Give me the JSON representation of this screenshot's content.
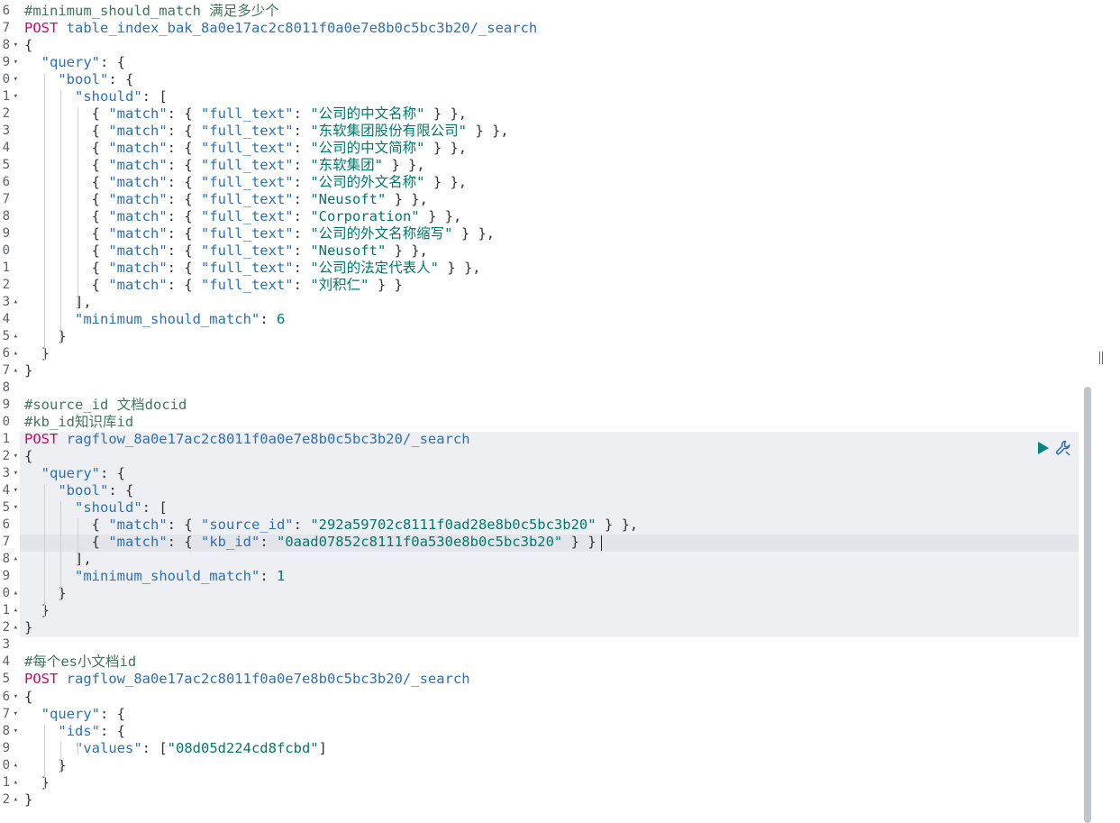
{
  "editor": {
    "gutter": [
      {
        "num": "6",
        "fold": ""
      },
      {
        "num": "7",
        "fold": ""
      },
      {
        "num": "8",
        "fold": "▾"
      },
      {
        "num": "9",
        "fold": "▾"
      },
      {
        "num": "0",
        "fold": "▾"
      },
      {
        "num": "1",
        "fold": "▾"
      },
      {
        "num": "2",
        "fold": ""
      },
      {
        "num": "3",
        "fold": ""
      },
      {
        "num": "4",
        "fold": ""
      },
      {
        "num": "5",
        "fold": ""
      },
      {
        "num": "6",
        "fold": ""
      },
      {
        "num": "7",
        "fold": ""
      },
      {
        "num": "8",
        "fold": ""
      },
      {
        "num": "9",
        "fold": ""
      },
      {
        "num": "0",
        "fold": ""
      },
      {
        "num": "1",
        "fold": ""
      },
      {
        "num": "2",
        "fold": ""
      },
      {
        "num": "3",
        "fold": "▴"
      },
      {
        "num": "4",
        "fold": ""
      },
      {
        "num": "5",
        "fold": "▴"
      },
      {
        "num": "6",
        "fold": "▴"
      },
      {
        "num": "7",
        "fold": "▴"
      },
      {
        "num": "8",
        "fold": ""
      },
      {
        "num": "9",
        "fold": ""
      },
      {
        "num": "0",
        "fold": ""
      },
      {
        "num": "1",
        "fold": ""
      },
      {
        "num": "2",
        "fold": "▾"
      },
      {
        "num": "3",
        "fold": "▾"
      },
      {
        "num": "4",
        "fold": "▾"
      },
      {
        "num": "5",
        "fold": "▾"
      },
      {
        "num": "6",
        "fold": ""
      },
      {
        "num": "7",
        "fold": ""
      },
      {
        "num": "8",
        "fold": "▴"
      },
      {
        "num": "9",
        "fold": ""
      },
      {
        "num": "0",
        "fold": "▴"
      },
      {
        "num": "1",
        "fold": "▴"
      },
      {
        "num": "2",
        "fold": "▴"
      },
      {
        "num": "3",
        "fold": ""
      },
      {
        "num": "4",
        "fold": ""
      },
      {
        "num": "5",
        "fold": ""
      },
      {
        "num": "6",
        "fold": "▾"
      },
      {
        "num": "7",
        "fold": "▾"
      },
      {
        "num": "8",
        "fold": "▾"
      },
      {
        "num": "9",
        "fold": ""
      },
      {
        "num": "0",
        "fold": "▴"
      },
      {
        "num": "1",
        "fold": "▴"
      },
      {
        "num": "2",
        "fold": "▴"
      }
    ],
    "lines": [
      [
        [
          "cmt",
          "#minimum_should_match 满足多少个"
        ]
      ],
      [
        [
          "mth",
          "POST"
        ],
        [
          "url",
          " table_index_bak_8a0e17ac2c8011f0a0e7e8b0c5bc3b20/_search"
        ]
      ],
      [
        [
          "pun",
          "{"
        ]
      ],
      [
        [
          "pun",
          "  "
        ],
        [
          "key",
          "\"query\""
        ],
        [
          "pun",
          ": {"
        ]
      ],
      [
        [
          "pun",
          "    "
        ],
        [
          "key",
          "\"bool\""
        ],
        [
          "pun",
          ": {"
        ]
      ],
      [
        [
          "pun",
          "      "
        ],
        [
          "key",
          "\"should\""
        ],
        [
          "pun",
          ": ["
        ]
      ],
      [
        [
          "pun",
          "        { "
        ],
        [
          "key",
          "\"match\""
        ],
        [
          "pun",
          ": { "
        ],
        [
          "key",
          "\"full_text\""
        ],
        [
          "pun",
          ": "
        ],
        [
          "str",
          "\"公司的中文名称\""
        ],
        [
          "pun",
          " } },"
        ]
      ],
      [
        [
          "pun",
          "        { "
        ],
        [
          "key",
          "\"match\""
        ],
        [
          "pun",
          ": { "
        ],
        [
          "key",
          "\"full_text\""
        ],
        [
          "pun",
          ": "
        ],
        [
          "str",
          "\"东软集团股份有限公司\""
        ],
        [
          "pun",
          " } },"
        ]
      ],
      [
        [
          "pun",
          "        { "
        ],
        [
          "key",
          "\"match\""
        ],
        [
          "pun",
          ": { "
        ],
        [
          "key",
          "\"full_text\""
        ],
        [
          "pun",
          ": "
        ],
        [
          "str",
          "\"公司的中文简称\""
        ],
        [
          "pun",
          " } },"
        ]
      ],
      [
        [
          "pun",
          "        { "
        ],
        [
          "key",
          "\"match\""
        ],
        [
          "pun",
          ": { "
        ],
        [
          "key",
          "\"full_text\""
        ],
        [
          "pun",
          ": "
        ],
        [
          "str",
          "\"东软集团\""
        ],
        [
          "pun",
          " } },"
        ]
      ],
      [
        [
          "pun",
          "        { "
        ],
        [
          "key",
          "\"match\""
        ],
        [
          "pun",
          ": { "
        ],
        [
          "key",
          "\"full_text\""
        ],
        [
          "pun",
          ": "
        ],
        [
          "str",
          "\"公司的外文名称\""
        ],
        [
          "pun",
          " } },"
        ]
      ],
      [
        [
          "pun",
          "        { "
        ],
        [
          "key",
          "\"match\""
        ],
        [
          "pun",
          ": { "
        ],
        [
          "key",
          "\"full_text\""
        ],
        [
          "pun",
          ": "
        ],
        [
          "str",
          "\"Neusoft\""
        ],
        [
          "pun",
          " } },"
        ]
      ],
      [
        [
          "pun",
          "        { "
        ],
        [
          "key",
          "\"match\""
        ],
        [
          "pun",
          ": { "
        ],
        [
          "key",
          "\"full_text\""
        ],
        [
          "pun",
          ": "
        ],
        [
          "str",
          "\"Corporation\""
        ],
        [
          "pun",
          " } },"
        ]
      ],
      [
        [
          "pun",
          "        { "
        ],
        [
          "key",
          "\"match\""
        ],
        [
          "pun",
          ": { "
        ],
        [
          "key",
          "\"full_text\""
        ],
        [
          "pun",
          ": "
        ],
        [
          "str",
          "\"公司的外文名称缩写\""
        ],
        [
          "pun",
          " } },"
        ]
      ],
      [
        [
          "pun",
          "        { "
        ],
        [
          "key",
          "\"match\""
        ],
        [
          "pun",
          ": { "
        ],
        [
          "key",
          "\"full_text\""
        ],
        [
          "pun",
          ": "
        ],
        [
          "str",
          "\"Neusoft\""
        ],
        [
          "pun",
          " } },"
        ]
      ],
      [
        [
          "pun",
          "        { "
        ],
        [
          "key",
          "\"match\""
        ],
        [
          "pun",
          ": { "
        ],
        [
          "key",
          "\"full_text\""
        ],
        [
          "pun",
          ": "
        ],
        [
          "str",
          "\"公司的法定代表人\""
        ],
        [
          "pun",
          " } },"
        ]
      ],
      [
        [
          "pun",
          "        { "
        ],
        [
          "key",
          "\"match\""
        ],
        [
          "pun",
          ": { "
        ],
        [
          "key",
          "\"full_text\""
        ],
        [
          "pun",
          ": "
        ],
        [
          "str",
          "\"刘积仁\""
        ],
        [
          "pun",
          " } }"
        ]
      ],
      [
        [
          "pun",
          "      ],"
        ]
      ],
      [
        [
          "pun",
          "      "
        ],
        [
          "key",
          "\"minimum_should_match\""
        ],
        [
          "pun",
          ": "
        ],
        [
          "num-v",
          "6"
        ]
      ],
      [
        [
          "pun",
          "    }"
        ]
      ],
      [
        [
          "pun",
          "  }"
        ]
      ],
      [
        [
          "pun",
          "}"
        ]
      ],
      [
        [
          "pun",
          ""
        ]
      ],
      [
        [
          "cmt",
          "#source_id 文档docid"
        ]
      ],
      [
        [
          "cmt",
          "#kb_id知识库id"
        ]
      ],
      [
        [
          "mth",
          "POST"
        ],
        [
          "url",
          " ragflow_8a0e17ac2c8011f0a0e7e8b0c5bc3b20/_search"
        ]
      ],
      [
        [
          "pun",
          "{"
        ]
      ],
      [
        [
          "pun",
          "  "
        ],
        [
          "key",
          "\"query\""
        ],
        [
          "pun",
          ": {"
        ]
      ],
      [
        [
          "pun",
          "    "
        ],
        [
          "key",
          "\"bool\""
        ],
        [
          "pun",
          ": {"
        ]
      ],
      [
        [
          "pun",
          "      "
        ],
        [
          "key",
          "\"should\""
        ],
        [
          "pun",
          ": ["
        ]
      ],
      [
        [
          "pun",
          "        { "
        ],
        [
          "key",
          "\"match\""
        ],
        [
          "pun",
          ": { "
        ],
        [
          "key",
          "\"source_id\""
        ],
        [
          "pun",
          ": "
        ],
        [
          "str",
          "\"292a59702c8111f0ad28e8b0c5bc3b20\""
        ],
        [
          "pun",
          " } },"
        ]
      ],
      [
        [
          "pun",
          "        { "
        ],
        [
          "key",
          "\"match\""
        ],
        [
          "pun",
          ": { "
        ],
        [
          "key",
          "\"kb_id\""
        ],
        [
          "pun",
          ": "
        ],
        [
          "str",
          "\"0aad07852c8111f0a530e8b0c5bc3b20\""
        ],
        [
          "pun",
          " } }"
        ]
      ],
      [
        [
          "pun",
          "      ],"
        ]
      ],
      [
        [
          "pun",
          "      "
        ],
        [
          "key",
          "\"minimum_should_match\""
        ],
        [
          "pun",
          ": "
        ],
        [
          "num-v",
          "1"
        ]
      ],
      [
        [
          "pun",
          "    }"
        ]
      ],
      [
        [
          "pun",
          "  }"
        ]
      ],
      [
        [
          "pun",
          "}"
        ]
      ],
      [
        [
          "pun",
          ""
        ]
      ],
      [
        [
          "cmt",
          "#每个es小文档id"
        ]
      ],
      [
        [
          "mth",
          "POST"
        ],
        [
          "url",
          " ragflow_8a0e17ac2c8011f0a0e7e8b0c5bc3b20/_search"
        ]
      ],
      [
        [
          "pun",
          "{"
        ]
      ],
      [
        [
          "pun",
          "  "
        ],
        [
          "key",
          "\"query\""
        ],
        [
          "pun",
          ": {"
        ]
      ],
      [
        [
          "pun",
          "    "
        ],
        [
          "key",
          "\"ids\""
        ],
        [
          "pun",
          ": {"
        ]
      ],
      [
        [
          "pun",
          "      "
        ],
        [
          "key",
          "\"values\""
        ],
        [
          "pun",
          ": ["
        ],
        [
          "str",
          "\"08d05d224cd8fcbd\""
        ],
        [
          "pun",
          "]"
        ]
      ],
      [
        [
          "pun",
          "    }"
        ]
      ],
      [
        [
          "pun",
          "  }"
        ]
      ],
      [
        [
          "pun",
          "}"
        ]
      ]
    ]
  },
  "colors": {
    "comment": "#41755c",
    "method": "#c80a68",
    "url": "#2e71b0",
    "key": "#2e71b0",
    "string": "#00796b",
    "request_highlight": "#eeeff3",
    "active_line": "#e4e5ea",
    "run_icon": "#00857a",
    "wrench_icon": "#2a6fb0"
  },
  "icons": {
    "run": "play-icon",
    "settings": "wrench-icon"
  }
}
